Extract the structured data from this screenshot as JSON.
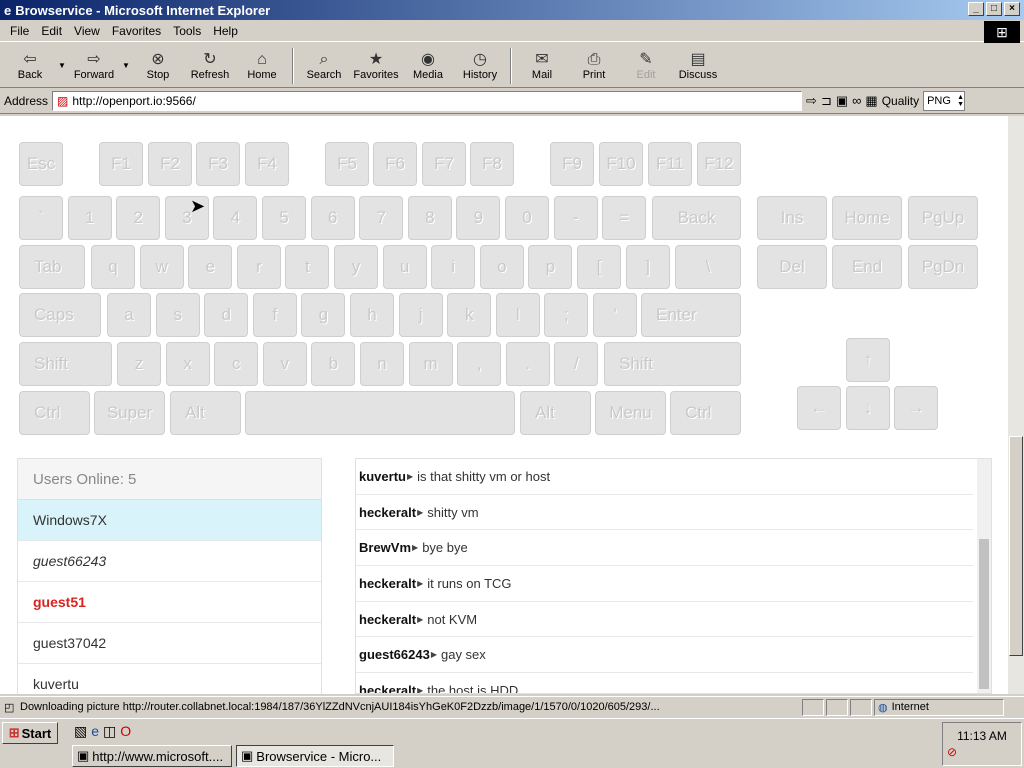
{
  "window": {
    "title": "Browservice - Microsoft Internet Explorer",
    "minimize": "_",
    "maximize": "□",
    "close": "×"
  },
  "menu": [
    "File",
    "Edit",
    "View",
    "Favorites",
    "Tools",
    "Help"
  ],
  "toolbar": {
    "back": "Back",
    "forward": "Forward",
    "stop": "Stop",
    "refresh": "Refresh",
    "home": "Home",
    "search": "Search",
    "favorites": "Favorites",
    "media": "Media",
    "history": "History",
    "mail": "Mail",
    "print": "Print",
    "edit": "Edit",
    "discuss": "Discuss"
  },
  "address": {
    "label": "Address",
    "url": "http://openport.io:9566/",
    "quality_label": "Quality",
    "quality_value": "PNG"
  },
  "keyboard": {
    "fn": [
      "Esc",
      "F1",
      "F2",
      "F3",
      "F4",
      "F5",
      "F6",
      "F7",
      "F8",
      "F9",
      "F10",
      "F11",
      "F12"
    ],
    "num": [
      "`",
      "1",
      "2",
      "3",
      "4",
      "5",
      "6",
      "7",
      "8",
      "9",
      "0",
      "-",
      "=",
      "Back"
    ],
    "tab": [
      "Tab",
      "q",
      "w",
      "e",
      "r",
      "t",
      "y",
      "u",
      "i",
      "o",
      "p",
      "[",
      "]",
      "\\"
    ],
    "caps": [
      "Caps",
      "a",
      "s",
      "d",
      "f",
      "g",
      "h",
      "j",
      "k",
      "l",
      ";",
      "'",
      "Enter"
    ],
    "shift": [
      "Shift",
      "z",
      "x",
      "c",
      "v",
      "b",
      "n",
      "m",
      ",",
      ".",
      "/",
      "Shift"
    ],
    "ctrl": [
      "Ctrl",
      "Super",
      "Alt",
      "",
      "Alt",
      "Menu",
      "Ctrl"
    ],
    "nav1": [
      "Ins",
      "Home",
      "PgUp"
    ],
    "nav2": [
      "Del",
      "End",
      "PgDn"
    ],
    "arrows": [
      "↑",
      "←",
      "↓",
      "→"
    ]
  },
  "users": {
    "header": "Users Online: 5",
    "list": [
      "Windows7X",
      "guest66243",
      "guest51",
      "guest37042",
      "kuvertu"
    ]
  },
  "chat": [
    {
      "name": "kuvertu",
      "text": "is that shitty vm or host"
    },
    {
      "name": "heckeralt",
      "text": "shitty vm"
    },
    {
      "name": "BrewVm",
      "text": "bye bye"
    },
    {
      "name": "heckeralt",
      "text": "it runs on TCG"
    },
    {
      "name": "heckeralt",
      "text": "not KVM"
    },
    {
      "name": "guest66243",
      "text": "gay sex"
    },
    {
      "name": "heckeralt",
      "text": "the host is HDD"
    }
  ],
  "status": {
    "text": "Downloading picture http://router.collabnet.local:1984/187/36YlZZdNVcnjAUI184isYhGeK0F2Dzzb/image/1/1570/0/1020/605/293/...",
    "zone": "Internet"
  },
  "taskbar": {
    "start": "Start",
    "tasks": [
      "http://www.microsoft....",
      "Browservice - Micro..."
    ],
    "clock": "11:13 AM"
  }
}
